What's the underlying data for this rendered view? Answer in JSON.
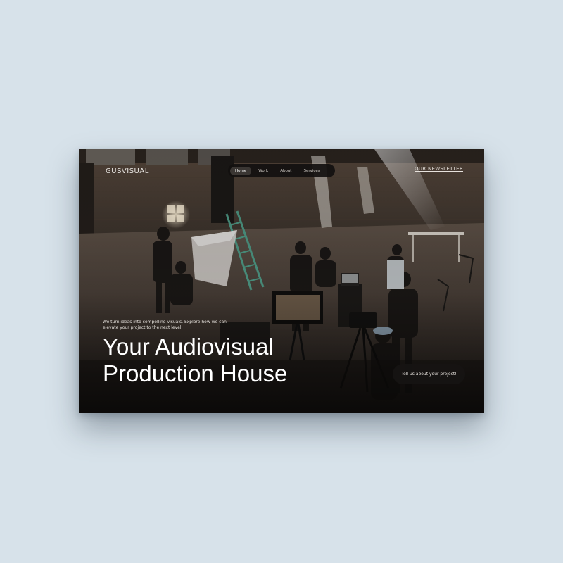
{
  "brand": {
    "name": "GUSVISUAL"
  },
  "nav": {
    "items": [
      {
        "label": "Home",
        "active": true
      },
      {
        "label": "Work",
        "active": false
      },
      {
        "label": "About",
        "active": false
      },
      {
        "label": "Services",
        "active": false
      }
    ]
  },
  "newsletter": {
    "label": "OUR NEWSLETTER"
  },
  "hero": {
    "intro": "We turn ideas into compelling visuals. Explore how we can elevate your project to the next level.",
    "headline_line1": "Your Audiovisual",
    "headline_line2": "Production House",
    "cta_label": "Tell us about your project!"
  },
  "colors": {
    "page_background": "#d7e2ea",
    "overlay": "#12100f",
    "text_light": "#ffffff"
  }
}
